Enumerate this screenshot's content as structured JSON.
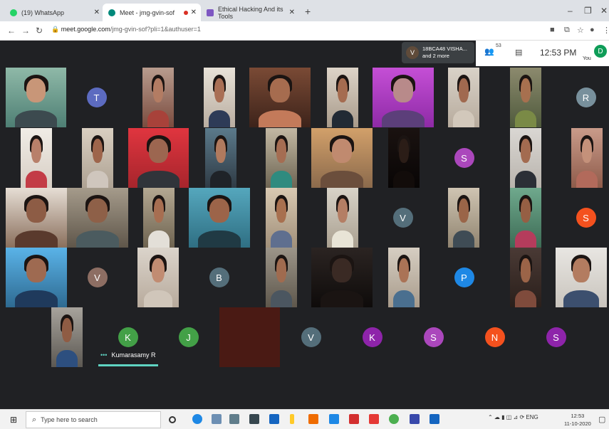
{
  "browser": {
    "tabs": [
      {
        "title": "(19) WhatsApp",
        "color": "#25d366"
      },
      {
        "title": "Meet - jmg-gvin-sof",
        "color": "#00897b"
      },
      {
        "title": "Ethical Hacking And its Tools",
        "color": "#7e57c2"
      }
    ],
    "new_tab_icon": "plus-icon",
    "url_host": "meet.google.com",
    "url_path": "/jmg-gvin-sof?pli=1&authuser=1"
  },
  "meet": {
    "presenter_initial": "V",
    "presenter_line1": "18BCA48 VISHA...",
    "presenter_line2": "and 2 more",
    "participants_count": "53",
    "time": "12:53 PM",
    "you_label": "You",
    "self_initial": "D",
    "speaking_dots": "•••",
    "speaking_name": "Kumarasamy R",
    "avatars": [
      {
        "letter": "T",
        "color": "#5c6bc0"
      },
      {
        "letter": "R",
        "color": "#78909c"
      },
      {
        "letter": "S",
        "color": "#ab47bc"
      },
      {
        "letter": "V",
        "color": "#546e7a"
      },
      {
        "letter": "S",
        "color": "#f4511e"
      },
      {
        "letter": "V",
        "color": "#8d6e63"
      },
      {
        "letter": "B",
        "color": "#546e7a"
      },
      {
        "letter": "P",
        "color": "#1e88e5"
      },
      {
        "letter": "K",
        "color": "#43a047"
      },
      {
        "letter": "J",
        "color": "#43a047"
      },
      {
        "letter": "V",
        "color": "#546e7a"
      },
      {
        "letter": "K",
        "color": "#8e24aa"
      },
      {
        "letter": "S",
        "color": "#ab47bc"
      },
      {
        "letter": "N",
        "color": "#f4511e"
      },
      {
        "letter": "S",
        "color": "#8e24aa"
      }
    ]
  },
  "taskbar": {
    "search_placeholder": "Type here to search",
    "time": "12:53",
    "date": "11-10-2020",
    "lang": "ENG"
  }
}
